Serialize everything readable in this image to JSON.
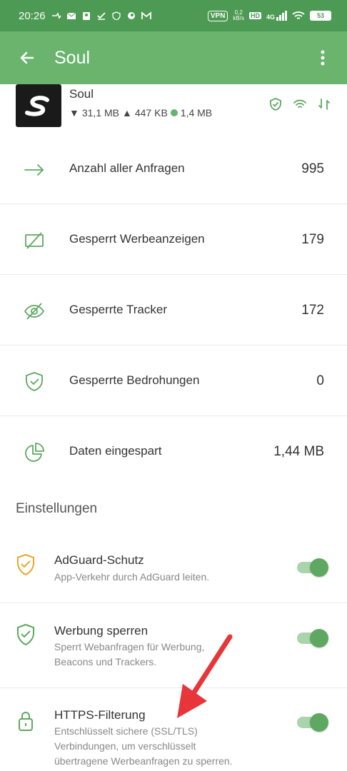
{
  "status_bar": {
    "time": "20:26",
    "vpn": "VPN",
    "speed_value": "0,2",
    "speed_unit": "kB/s",
    "hd": "HD",
    "network": "4G",
    "battery": "53"
  },
  "app_bar": {
    "title": "Soul"
  },
  "app": {
    "name": "Soul",
    "download": "31,1 MB",
    "upload": "447 KB",
    "saved": "1,4 MB"
  },
  "stats": [
    {
      "label": "Anzahl aller Anfragen",
      "value": "995",
      "icon": "arrow-right-icon"
    },
    {
      "label": "Gesperrt Werbeanzeigen",
      "value": "179",
      "icon": "ad-blocked-icon"
    },
    {
      "label": "Gesperrte Tracker",
      "value": "172",
      "icon": "eye-off-icon"
    },
    {
      "label": "Gesperrte Bedrohungen",
      "value": "0",
      "icon": "shield-check-icon"
    },
    {
      "label": "Daten eingespart",
      "value": "1,44 MB",
      "icon": "pie-chart-icon"
    }
  ],
  "settings_title": "Einstellungen",
  "settings": [
    {
      "title": "AdGuard-Schutz",
      "subtitle": "App-Verkehr durch AdGuard leiten.",
      "enabled": true,
      "icon": "shield-check-icon"
    },
    {
      "title": "Werbung sperren",
      "subtitle": "Sperrt Webanfragen für Werbung, Beacons und Trackers.",
      "enabled": true,
      "icon": "shield-check-icon"
    },
    {
      "title": "HTTPS-Filterung",
      "subtitle": "Entschlüsselt sichere (SSL/TLS) Verbindungen, um verschlüsselt übertragene Werbeanfragen zu sperren.",
      "enabled": true,
      "icon": "lock-icon"
    }
  ],
  "colors": {
    "status_bar": "#4c9a53",
    "app_bar": "#6ab46e",
    "accent": "#5ea862",
    "warning": "#e8a82a",
    "annotation_arrow": "#e8353a"
  }
}
